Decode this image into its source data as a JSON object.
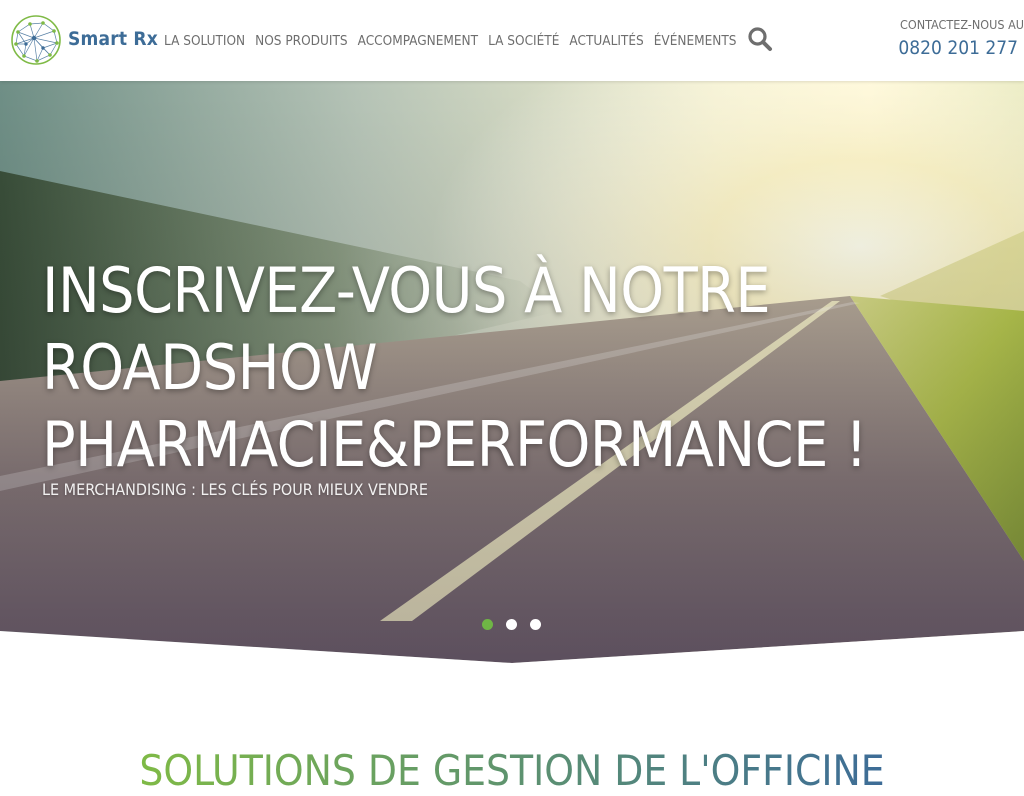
{
  "brand": {
    "name": "Smart Rx"
  },
  "nav": {
    "items": [
      {
        "label": "LA SOLUTION"
      },
      {
        "label": "NOS PRODUITS"
      },
      {
        "label": "ACCOMPAGNEMENT"
      },
      {
        "label": "LA SOCIÉTÉ"
      },
      {
        "label": "ACTUALITÉS"
      },
      {
        "label": "ÉVÉNEMENTS"
      }
    ],
    "search_icon": "search-icon"
  },
  "contact": {
    "label": "CONTACTEZ-NOUS AU",
    "phone": "0820 201 277"
  },
  "hero": {
    "title_lines": [
      "INSCRIVEZ-VOUS À NOTRE",
      "ROADSHOW",
      "PHARMACIE&PERFORMANCE !"
    ],
    "subtitle": "LE MERCHANDISING : LES CLÉS POUR MIEUX VENDRE",
    "slides_total": 3,
    "active_slide": 1
  },
  "section": {
    "title": "SOLUTIONS DE GESTION DE L'OFFICINE"
  },
  "colors": {
    "brand_blue": "#3d6c97",
    "brand_green": "#7fba46",
    "nav_text": "#6e6e6e",
    "dot_active": "#6fb545",
    "dot_inactive": "#ffffff",
    "section_gradient_start": "#7fba46",
    "section_gradient_end": "#3d6c97"
  }
}
